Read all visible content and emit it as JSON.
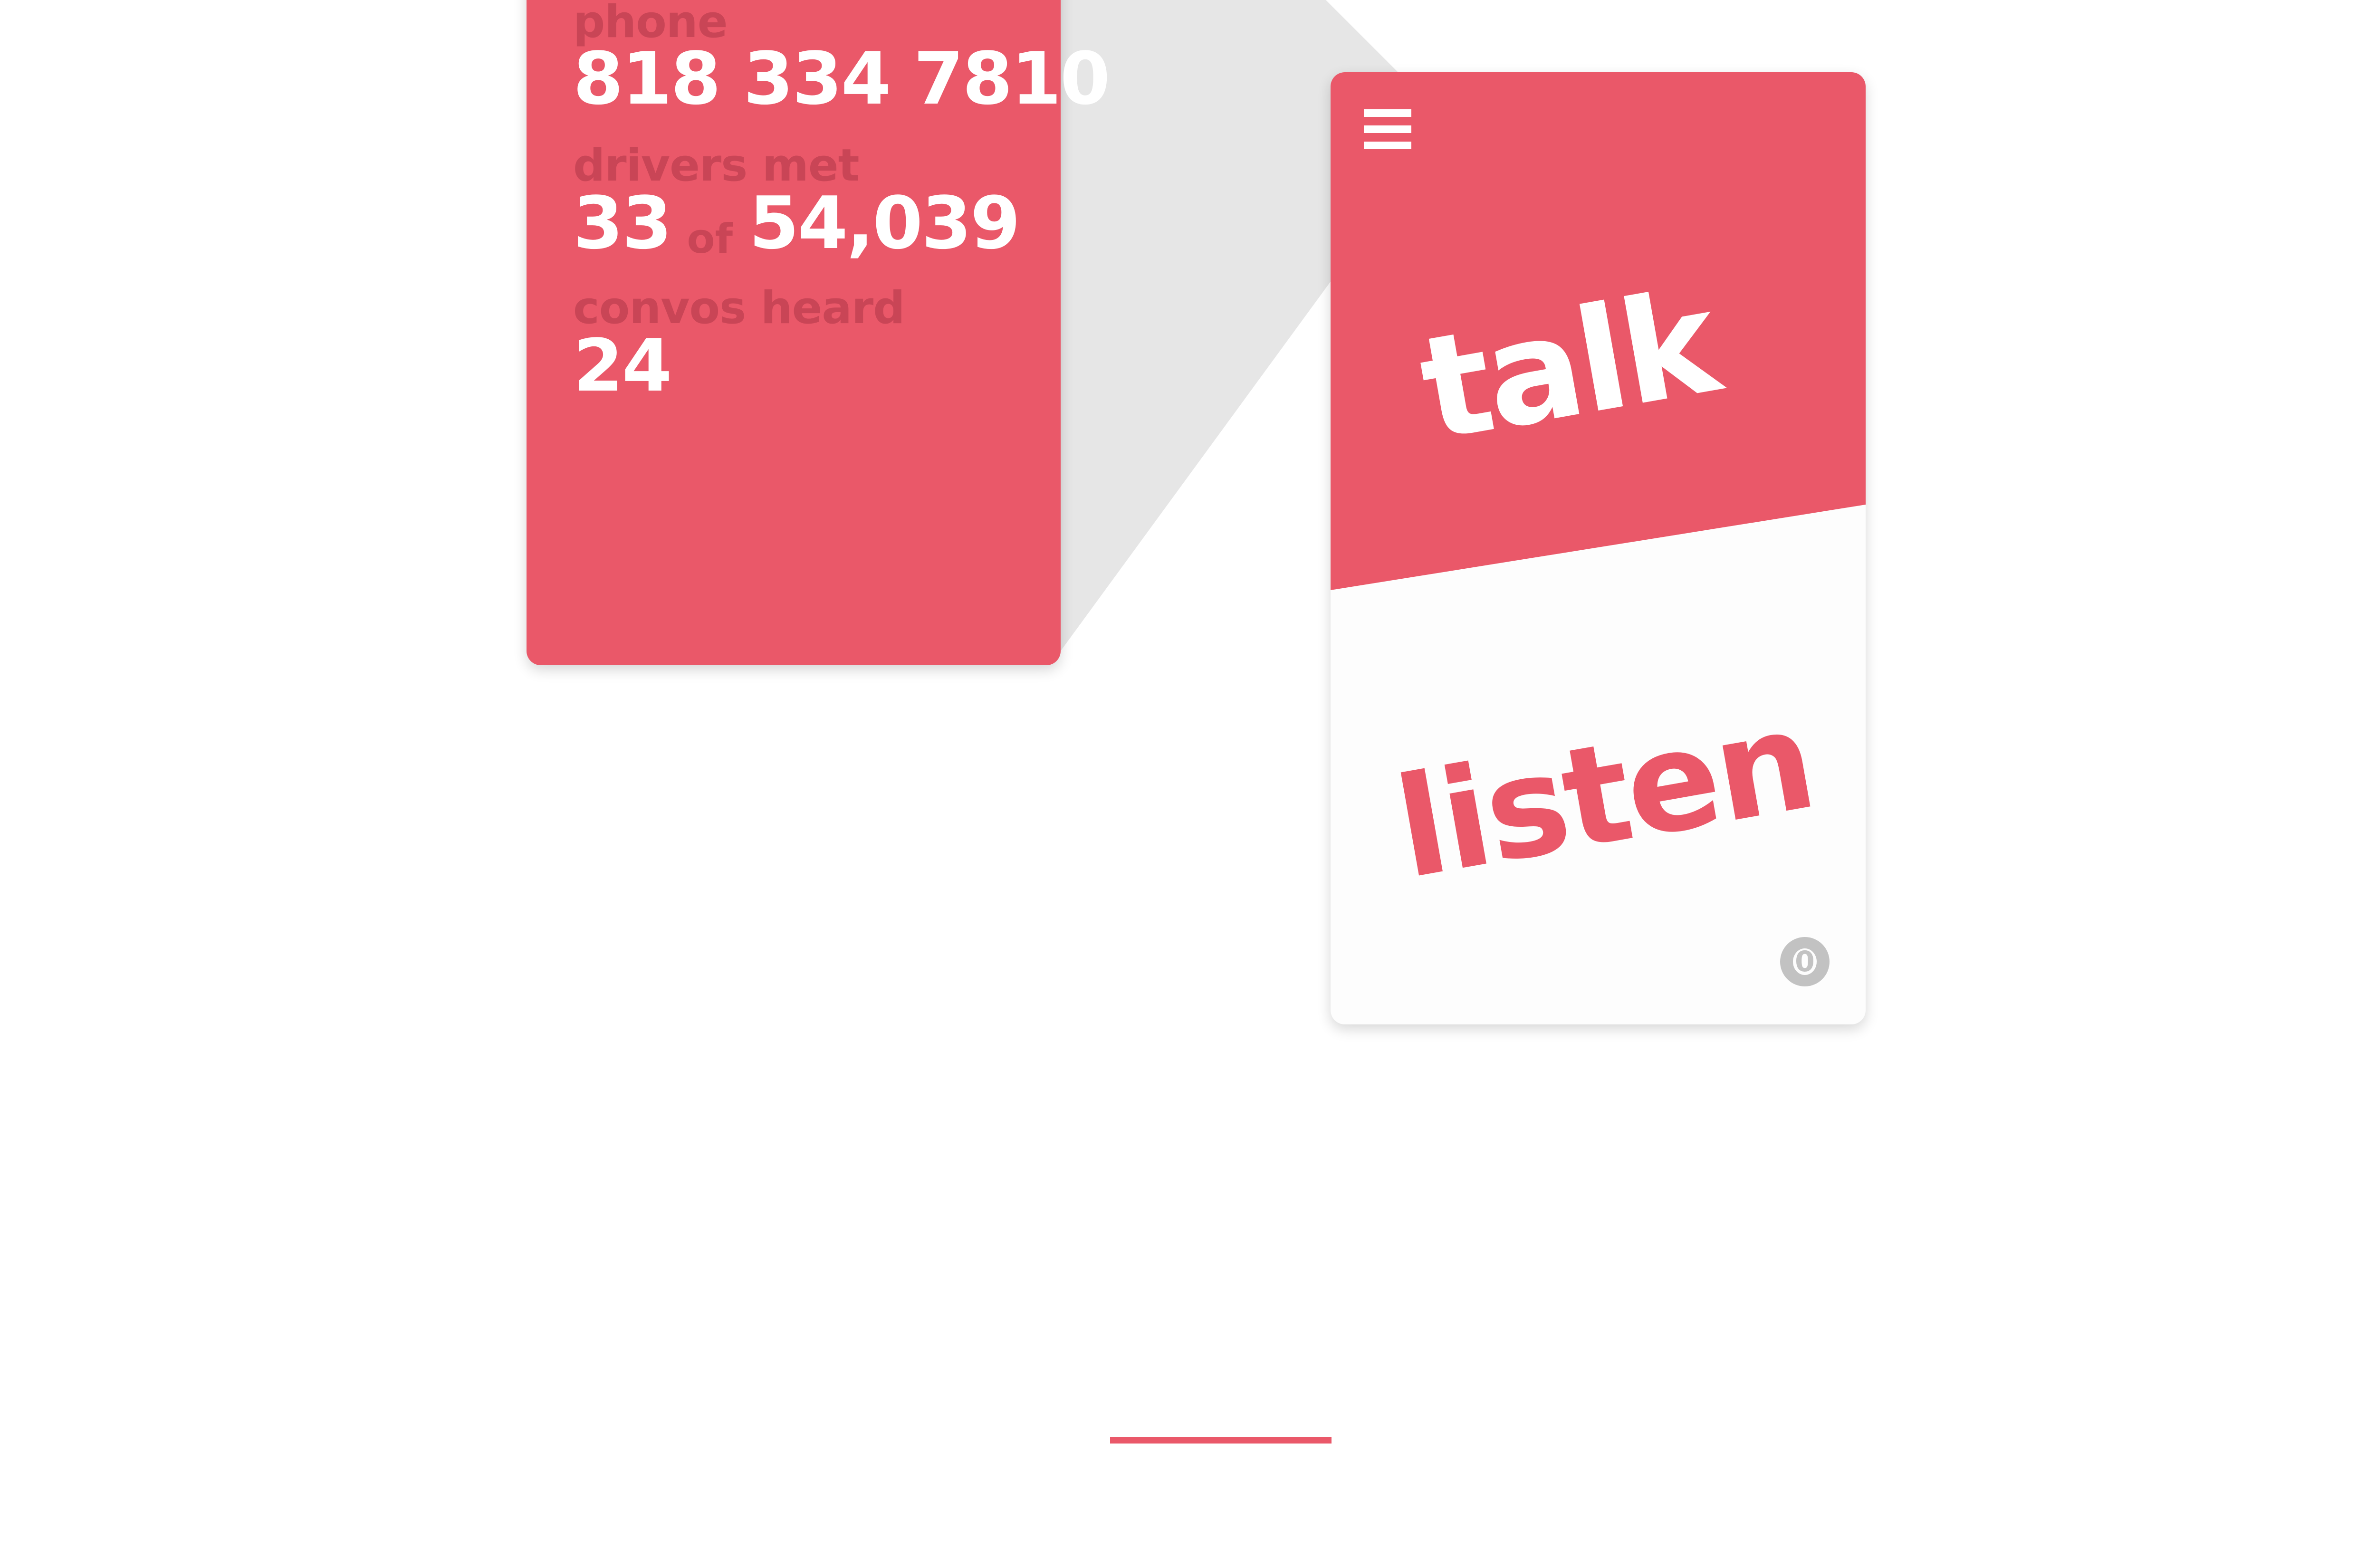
{
  "stats_card": {
    "phone_label": "phone",
    "phone_value": "818 334 7810",
    "drivers_label": "drivers met",
    "drivers_met": "33",
    "drivers_of": "of",
    "drivers_total": "54,039",
    "convos_label": "convos heard",
    "convos_value": "24"
  },
  "phone_screen": {
    "menu_icon": "hamburger-menu-icon",
    "talk_label": "talk",
    "listen_label": "listen",
    "badge_count": "0"
  },
  "colors": {
    "accent": "#ea5869",
    "label_muted": "#c94556",
    "connector_gray": "#e6e6e6",
    "badge_gray": "#c2c2c2"
  }
}
